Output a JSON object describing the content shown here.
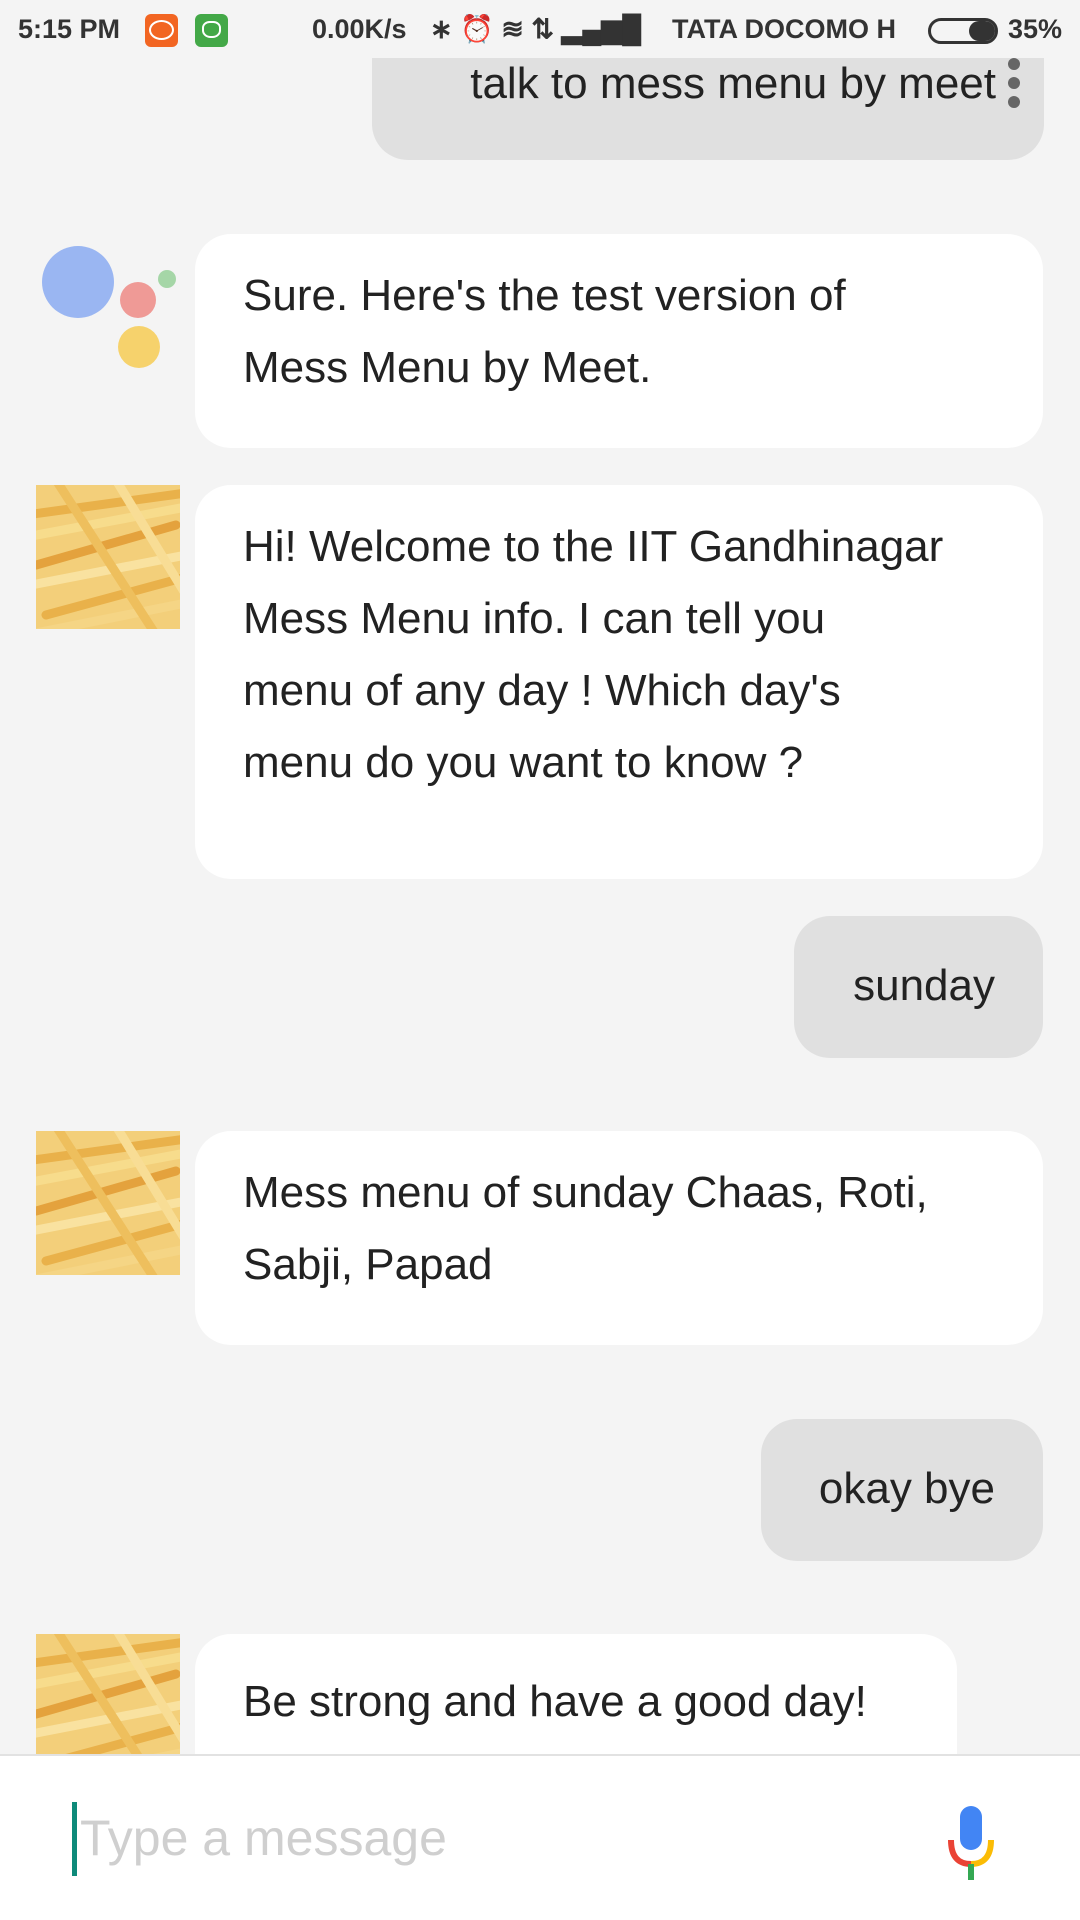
{
  "status_bar": {
    "time": "5:15 PM",
    "network_speed": "0.00K/s",
    "status_icons": "∗ ⏰ ≋ ⇅ ▂▄▆█",
    "carrier": "TATA DOCOMO",
    "network_type": "H",
    "battery": "35%"
  },
  "messages": [
    {
      "role": "user",
      "text": "talk to mess menu by meet"
    },
    {
      "role": "assistant",
      "lines": [
        "Sure. Here's the test version of",
        "Mess Menu by Meet."
      ]
    },
    {
      "role": "agent",
      "lines": [
        "Hi! Welcome to the IIT Gandhinagar",
        "Mess Menu info. I can tell you",
        "menu of any day ! Which day's",
        "menu do you want to know ?"
      ]
    },
    {
      "role": "user",
      "text": "sunday"
    },
    {
      "role": "agent",
      "lines": [
        "Mess menu of sunday Chaas, Roti,",
        "Sabji, Papad"
      ]
    },
    {
      "role": "user",
      "text": "okay bye"
    },
    {
      "role": "agent",
      "lines": [
        "Be strong and have a good day!"
      ]
    }
  ],
  "input": {
    "placeholder": "Type a message"
  },
  "icons": {
    "mic": "mic-icon",
    "overflow": "more-vert-icon"
  },
  "colors": {
    "background": "#f4f4f4",
    "user_bubble": "#e0e0e0",
    "agent_bubble": "#ffffff",
    "cursor": "#0e8a7a"
  }
}
